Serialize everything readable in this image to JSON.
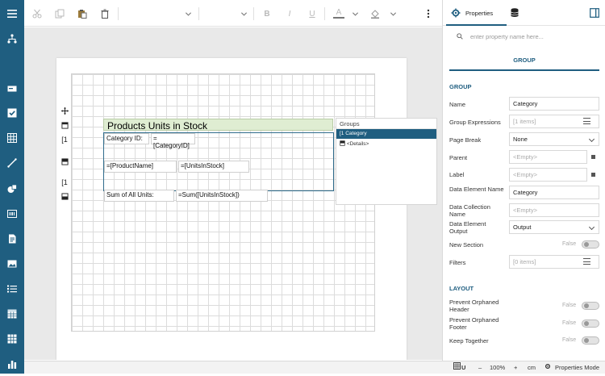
{
  "designer": {
    "title_cell": "Products Units in Stock",
    "category_label": "Category ID:",
    "category_field": "=[CategoryID]",
    "product_name_field": "=[ProductName]",
    "units_field": "=[UnitsInStock]",
    "sum_label": "Sum of All Units:",
    "sum_field": "=Sum([UnitsInStock])",
    "band_marker": "[1",
    "groups_panel": {
      "header": "Groups",
      "items": [
        "[1 Category",
        "<Details>"
      ]
    }
  },
  "toolbar": {
    "bold": "B",
    "italic": "I",
    "underline": "U",
    "font_color": "A"
  },
  "statusbar": {
    "underline": "U",
    "minus": "–",
    "zoom": "100%",
    "plus": "+",
    "unit": "cm",
    "mode": "Properties Mode"
  },
  "properties": {
    "tab_label": "Properties",
    "search_placeholder": "enter property name here...",
    "group_tab": "GROUP",
    "section_group": "GROUP",
    "section_layout": "LAYOUT",
    "fields": {
      "name_label": "Name",
      "name_value": "Category",
      "group_expr_label": "Group Expressions",
      "group_expr_value": "[1 items]",
      "page_break_label": "Page Break",
      "page_break_value": "None",
      "parent_label": "Parent",
      "parent_value": "<Empty>",
      "label_label": "Label",
      "label_value": "<Empty>",
      "data_element_name_label": "Data Element Name",
      "data_element_name_value": "Category",
      "data_collection_name_label": "Data Collection Name",
      "data_collection_name_value": "<Empty>",
      "data_element_output_label": "Data Element Output",
      "data_element_output_value": "Output",
      "new_section_label": "New Section",
      "new_section_value": "False",
      "filters_label": "Filters",
      "filters_value": "[0 items]",
      "prevent_orphaned_header_label": "Prevent Orphaned Header",
      "prevent_orphaned_header_value": "False",
      "prevent_orphaned_footer_label": "Prevent Orphaned Footer",
      "prevent_orphaned_footer_value": "False",
      "keep_together_label": "Keep Together",
      "keep_together_value": "False"
    }
  }
}
